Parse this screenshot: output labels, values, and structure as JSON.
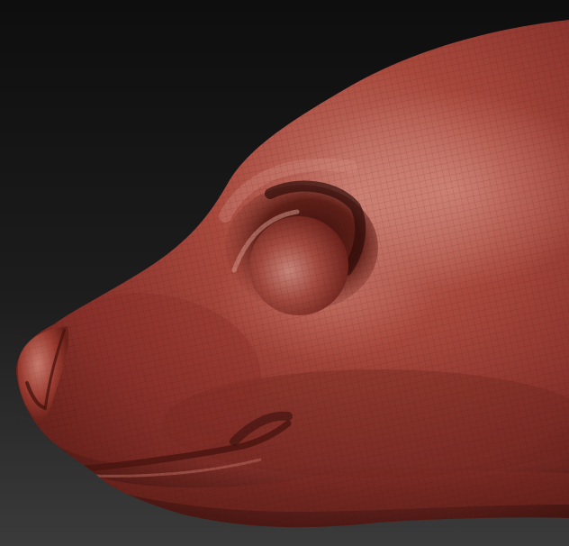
{
  "scene": {
    "subject": "sculpted-animal-head-side-profile",
    "colors": {
      "background_top": "#0e0e0e",
      "background_bottom": "#3a3a3a",
      "clay_base": "#9a3b30",
      "clay_light": "#c9786c",
      "clay_shadow": "#5a1c16",
      "clay_deep": "#3a0f0b",
      "wireframe": "#4a1410"
    }
  }
}
